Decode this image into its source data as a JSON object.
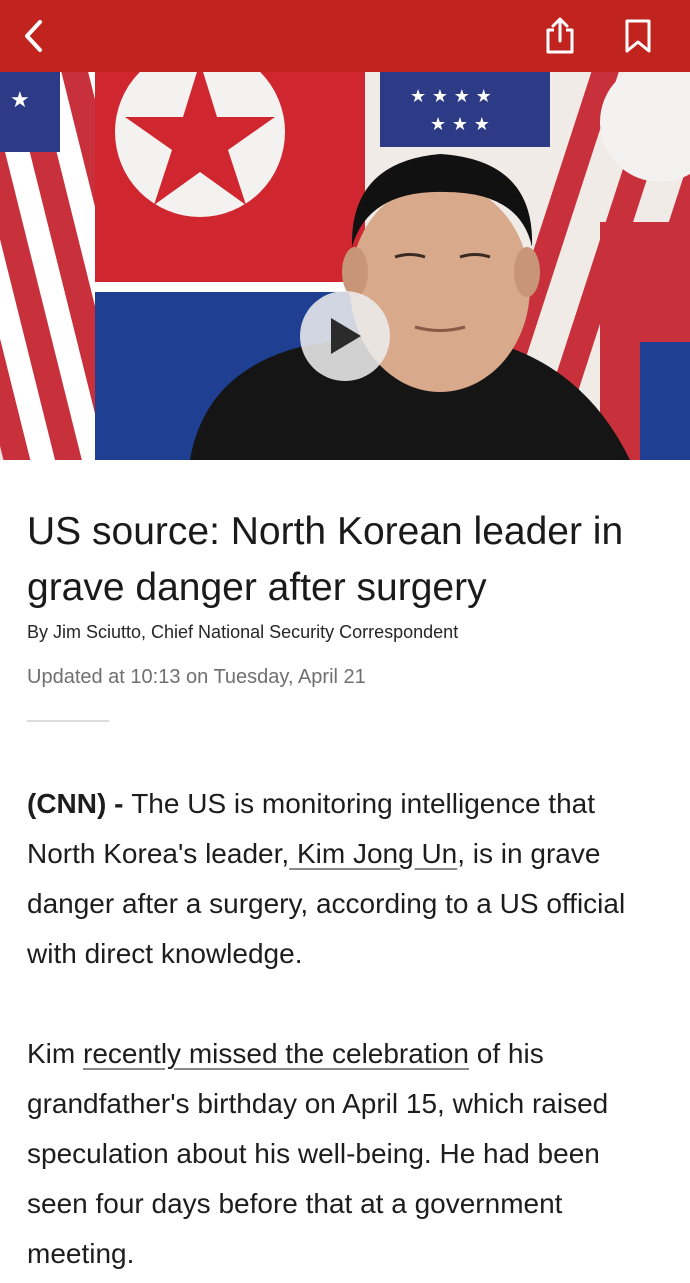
{
  "topbar": {
    "background": "#c1241f",
    "icons": [
      "chevron-left-icon",
      "share-icon",
      "bookmark-icon"
    ]
  },
  "hero": {
    "play_icon": "play-icon"
  },
  "article": {
    "headline": "US source: North Korean leader in grave danger after surgery",
    "byline": "By Jim Sciutto, Chief National Security Correspondent",
    "updated": "Updated at 10:13 on Tuesday, April 21",
    "p1": {
      "source": "(CNN)",
      "separator": " - ",
      "text_before_link": "The US is monitoring intelligence that North Korea's leader,",
      "link": " Kim Jong Un",
      "text_after_link": ", is in grave danger after a surgery, according to a US official with direct knowledge."
    },
    "p2": {
      "text_before_link": "Kim ",
      "link": "recently missed the celebration",
      "text_after_link": " of his grandfather's birthday on April 15, which raised speculation about his well-being. He had been seen four days before that at a government meeting."
    }
  }
}
